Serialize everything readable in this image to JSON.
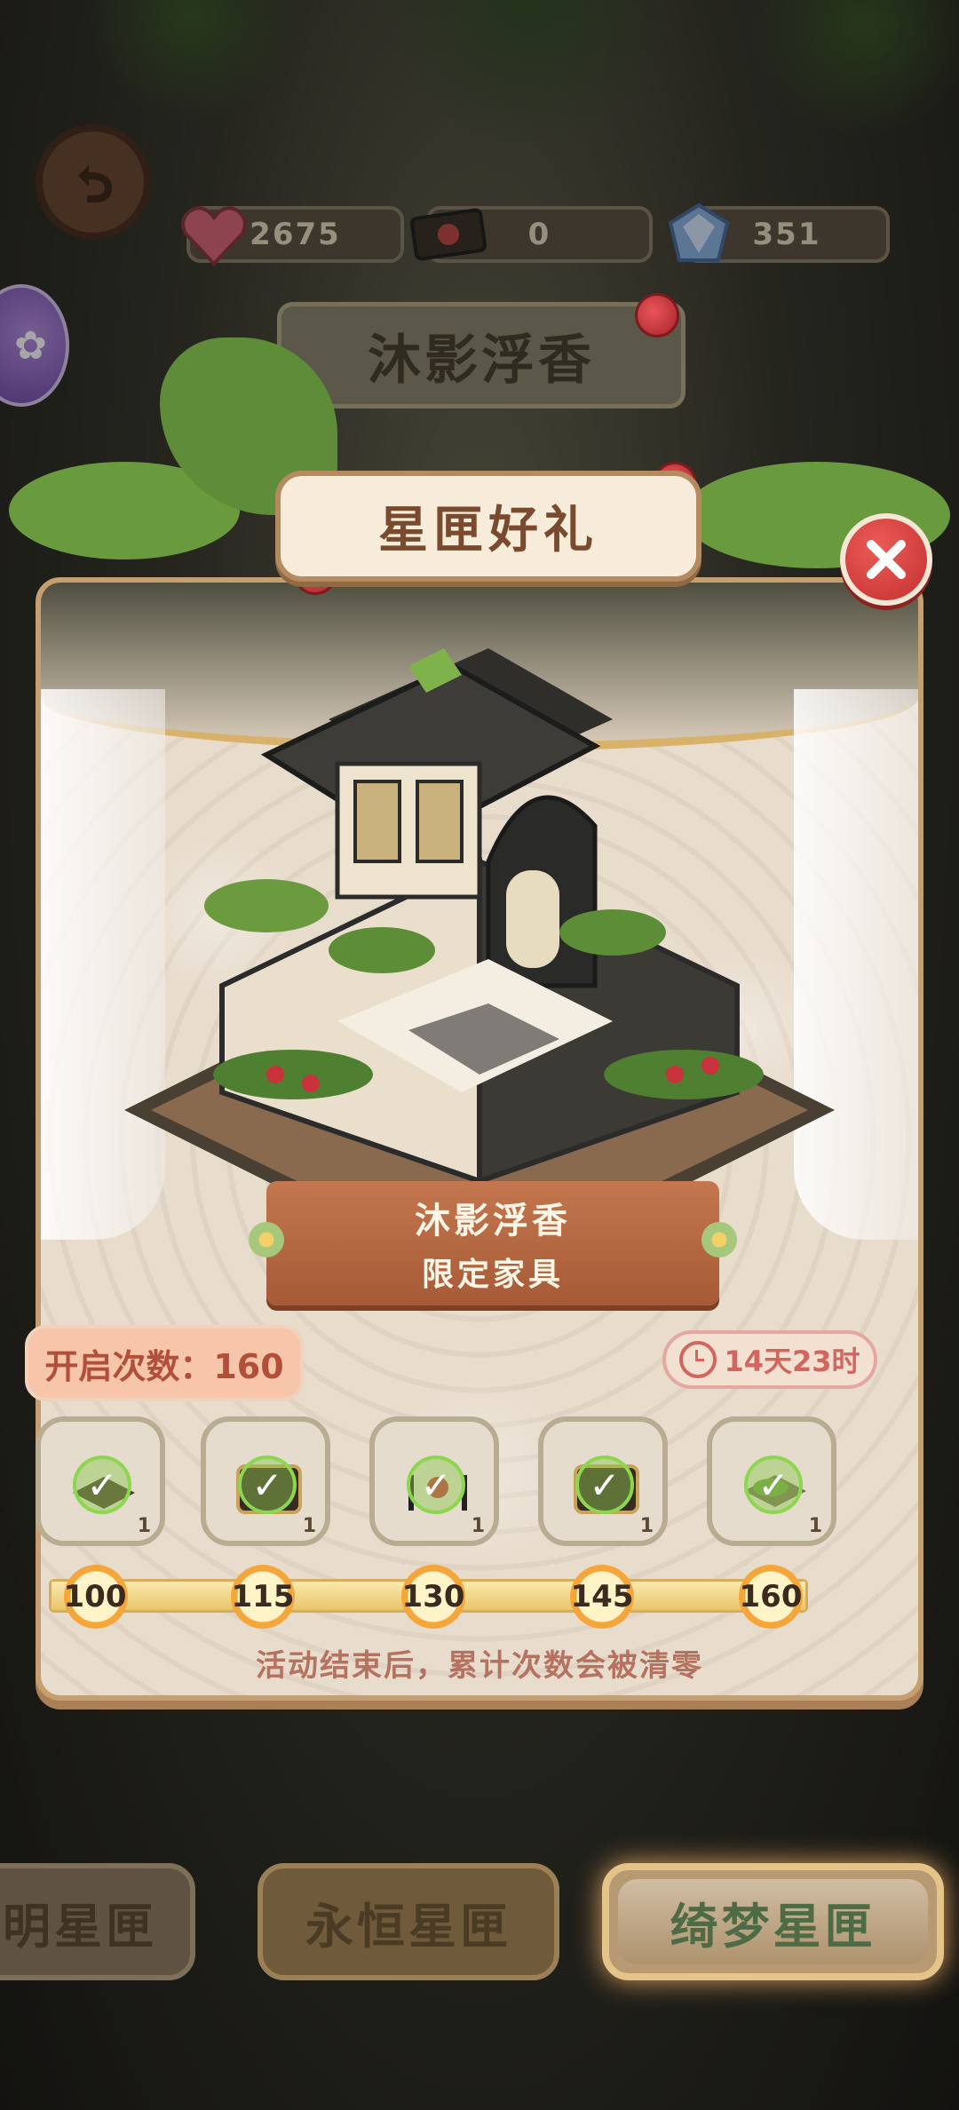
{
  "resources": {
    "hearts": "2675",
    "tickets": "0",
    "gems": "351"
  },
  "background": {
    "event_title": "沐影浮香",
    "event_timer": "14天23时"
  },
  "modal": {
    "title": "星匣好礼",
    "ribbon_line1": "沐影浮香",
    "ribbon_line2": "限定家具",
    "open_count_label": "开启次数：160",
    "timer": "14天23时",
    "footnote": "活动结束后，累计次数会被清零",
    "progress_fraction": 1.0,
    "rewards": [
      {
        "icon": "rug-icon",
        "qty": "1",
        "claimed": true
      },
      {
        "icon": "treasure-chest-icon",
        "qty": "1",
        "claimed": true
      },
      {
        "icon": "rose-fence-icon",
        "qty": "1",
        "claimed": true
      },
      {
        "icon": "treasure-chest-icon",
        "qty": "1",
        "claimed": true
      },
      {
        "icon": "garden-plot-icon",
        "qty": "1",
        "claimed": true
      }
    ],
    "milestones": [
      "100",
      "115",
      "130",
      "145",
      "160"
    ]
  },
  "tabs": {
    "tab1": "明星匣",
    "tab2": "永恒星匣",
    "tab3": "绮梦星匣"
  },
  "colors": {
    "accent": "#c4774e",
    "close": "#d63c3a",
    "claimed_check": "#8cd650"
  }
}
